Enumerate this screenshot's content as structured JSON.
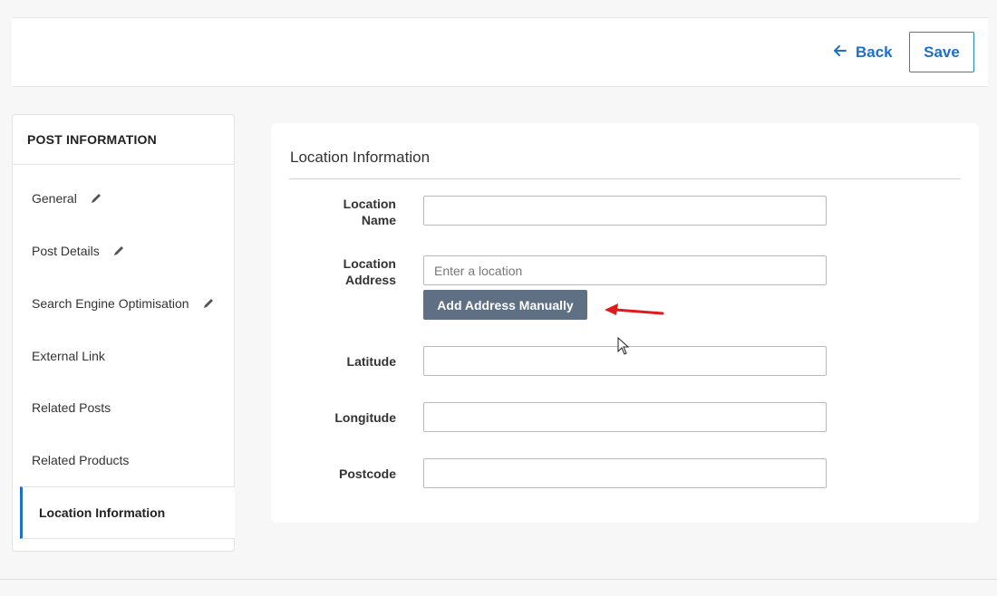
{
  "topbar": {
    "back_label": "Back",
    "save_label": "Save"
  },
  "sidebar": {
    "header": "POST INFORMATION",
    "items": [
      {
        "label": "General",
        "editable": true
      },
      {
        "label": "Post Details",
        "editable": true
      },
      {
        "label": "Search Engine Optimisation",
        "editable": true
      },
      {
        "label": "External Link",
        "editable": false
      },
      {
        "label": "Related Posts",
        "editable": false
      },
      {
        "label": "Related Products",
        "editable": false
      },
      {
        "label": "Location Information",
        "editable": false,
        "active": true
      }
    ]
  },
  "panel": {
    "title": "Location Information",
    "fields": {
      "location_name": {
        "label_line1": "Location",
        "label_line2": "Name",
        "value": ""
      },
      "location_address": {
        "label_line1": "Location",
        "label_line2": "Address",
        "value": "",
        "placeholder": "Enter a location"
      },
      "latitude": {
        "label": "Latitude",
        "value": ""
      },
      "longitude": {
        "label": "Longitude",
        "value": ""
      },
      "postcode": {
        "label": "Postcode",
        "value": ""
      }
    },
    "add_manually_label": "Add Address Manually"
  },
  "colors": {
    "accent": "#1f6fc5",
    "button_bg": "#5f7085",
    "annotation_arrow": "#e01b1b"
  },
  "icons": {
    "back": "arrow-left-icon",
    "edit": "pencil-icon",
    "cursor": "mouse-pointer-icon"
  }
}
